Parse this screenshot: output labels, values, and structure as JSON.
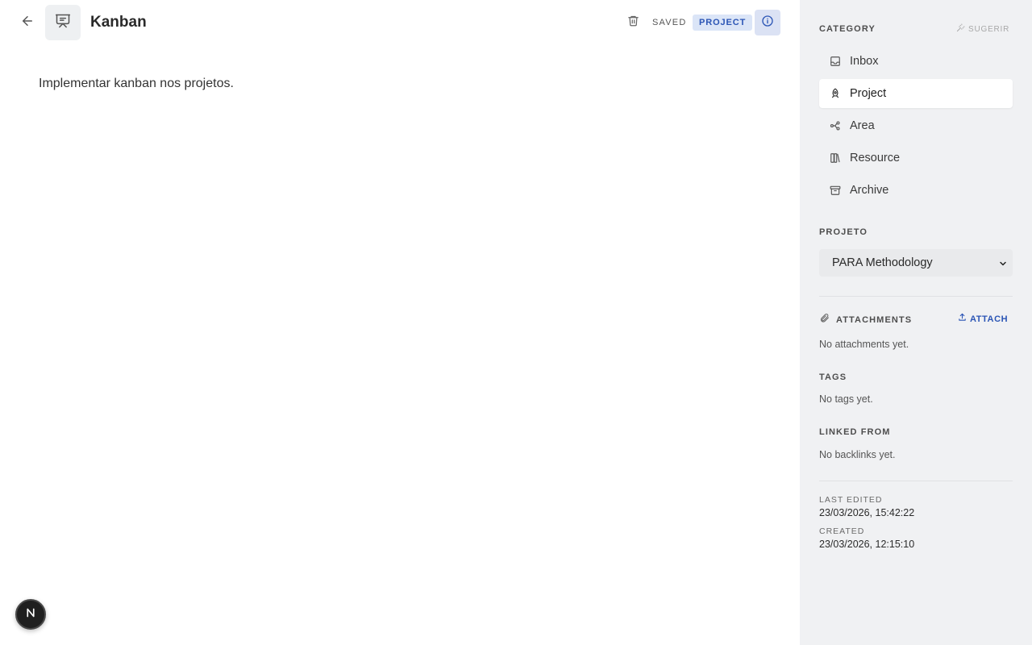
{
  "header": {
    "title": "Kanban",
    "status": "SAVED",
    "category_badge": "PROJECT"
  },
  "document": {
    "body": "Implementar kanban nos projetos."
  },
  "floating_badge": {
    "letter": "N"
  },
  "sidebar": {
    "category_label": "CATEGORY",
    "suggest_label": "SUGERIR",
    "categories": [
      {
        "label": "Inbox",
        "icon": "inbox-icon",
        "active": false
      },
      {
        "label": "Project",
        "icon": "rocket-icon",
        "active": true
      },
      {
        "label": "Area",
        "icon": "network-icon",
        "active": false
      },
      {
        "label": "Resource",
        "icon": "library-icon",
        "active": false
      },
      {
        "label": "Archive",
        "icon": "archive-icon",
        "active": false
      }
    ],
    "project_label": "PROJETO",
    "project_value": "PARA Methodology",
    "attachments_label": "ATTACHMENTS",
    "attach_label": "ATTACH",
    "attachments_empty": "No attachments yet.",
    "tags_label": "TAGS",
    "tags_empty": "No tags yet.",
    "linked_label": "LINKED FROM",
    "linked_empty": "No backlinks yet.",
    "last_edited_label": "LAST EDITED",
    "last_edited_value": "23/03/2026, 15:42:22",
    "created_label": "CREATED",
    "created_value": "23/03/2026, 12:15:10"
  },
  "colors": {
    "accent": "#2b55b5",
    "badge_bg": "#dbe5f7",
    "sidebar_bg": "#f0f1f3"
  }
}
